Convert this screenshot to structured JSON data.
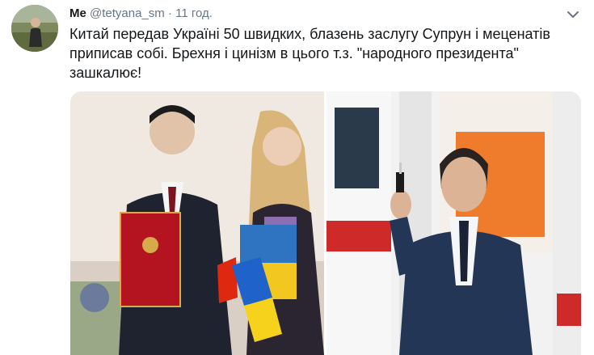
{
  "tweet": {
    "author_name": "Ме",
    "handle": "@tetyana_sm",
    "separator": "·",
    "time": "11 год.",
    "text_lines": [
      "Китай передав Україні 50 швидких, блазень заслугу Супрун і меценатів",
      "приписав собі. Брехня і цинізм в цього т.з. \"народного президента\"",
      "зашкалює!"
    ]
  },
  "icons": {
    "more": "chevron-down-icon",
    "avatar": "avatar"
  },
  "colors": {
    "text": "#14171a",
    "secondary": "#657786",
    "background": "#ffffff"
  }
}
